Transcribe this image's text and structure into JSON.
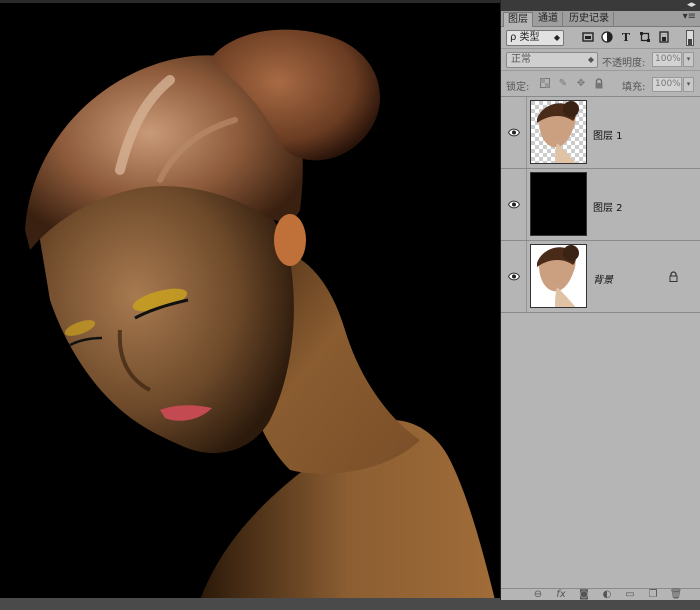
{
  "tabs": [
    "图层",
    "通道",
    "历史记录"
  ],
  "filter": {
    "kind_label": "ρ 类型",
    "icons": [
      "image-filter-icon",
      "adjustment-filter-icon",
      "type-filter-icon",
      "shape-filter-icon",
      "smart-object-filter-icon"
    ]
  },
  "blend": {
    "mode": "正常",
    "opacity_label": "不透明度:",
    "opacity_value": "100%"
  },
  "lock": {
    "label": "锁定:",
    "fill_label": "填充:",
    "fill_value": "100%"
  },
  "layers": [
    {
      "name": "图层 1",
      "visible": true,
      "thumb": "transparent-portrait",
      "locked": false
    },
    {
      "name": "图层 2",
      "visible": true,
      "thumb": "black-fill",
      "locked": false
    },
    {
      "name": "背景",
      "visible": true,
      "thumb": "portrait",
      "locked": true
    }
  ],
  "footer_icons": [
    "link-layers-icon",
    "fx-icon",
    "mask-icon",
    "adjustment-icon",
    "group-icon",
    "new-layer-icon",
    "trash-icon"
  ],
  "colors": {
    "panel_bg": "#b5b5b5",
    "canvas_bg": "#000000",
    "skin": "#8a5a2e",
    "hair": "#7a4a2a"
  }
}
